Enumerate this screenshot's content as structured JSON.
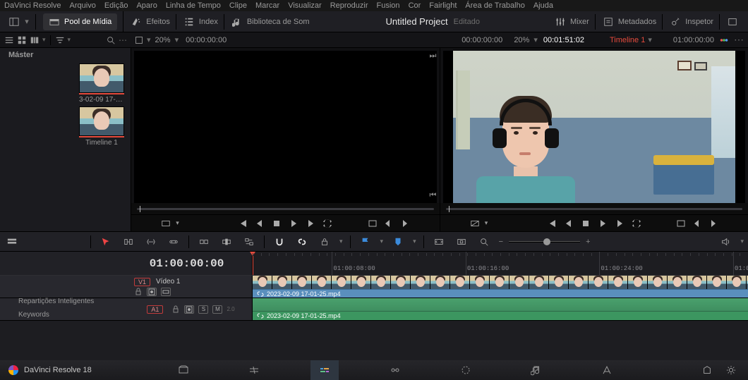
{
  "app_name": "DaVinci Resolve",
  "menu": [
    "DaVinci Resolve",
    "Arquivo",
    "Edição",
    "Aparo",
    "Linha de Tempo",
    "Clipe",
    "Marcar",
    "Visualizar",
    "Reproduzir",
    "Fusion",
    "Cor",
    "Fairlight",
    "Área de Trabalho",
    "Ajuda"
  ],
  "ws_toolbar": {
    "media_pool": "Pool de Mídia",
    "effects": "Efeitos",
    "index": "Index",
    "sound_library": "Biblioteca de Som",
    "mixer": "Mixer",
    "metadata": "Metadados",
    "inspector": "Inspetor"
  },
  "project": {
    "title": "Untitled Project",
    "state": "Editado"
  },
  "source_viewer": {
    "zoom": "20%",
    "tc": "00:00:00:00"
  },
  "program_viewer": {
    "zoom": "20%",
    "in_tc": "00:00:00:00",
    "duration": "00:01:51:02",
    "timeline_name": "Timeline 1",
    "out_tc": "01:00:00:00"
  },
  "media_pool": {
    "master_label": "Máster",
    "clips": [
      {
        "name": "3-02-09 17-01-"
      },
      {
        "name": "Timeline 1"
      }
    ],
    "smart_bins_label": "Repartições Inteligentes",
    "keywords_label": "Keywords"
  },
  "timeline": {
    "playhead_tc": "01:00:00:00",
    "ruler_labels": [
      "01:00:08:00",
      "01:00:16:00",
      "01:00:24:00",
      "01:0"
    ],
    "video_track": {
      "badge": "V1",
      "name": "Vídeo 1",
      "clip_name": "2023-02-09 17-01-25.mp4"
    },
    "audio_track": {
      "badge": "A1",
      "clip_name": "2023-02-09 17-01-25.mp4",
      "button_s": "S",
      "button_m": "M",
      "db": "2.0"
    }
  },
  "brand": "DaVinci Resolve 18"
}
